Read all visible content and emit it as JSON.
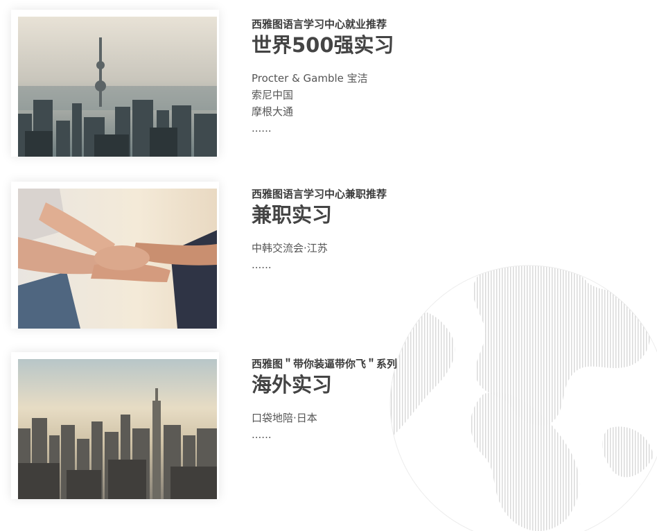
{
  "sections": [
    {
      "subtitle": "西雅图语言学习中心就业推荐",
      "title": "世界500强实习",
      "items": [
        "Procter & Gamble 宝洁",
        "索尼中国",
        "摩根大通",
        "......"
      ]
    },
    {
      "subtitle": "西雅图语言学习中心兼职推荐",
      "title": "兼职实习",
      "items": [
        "中韩交流会·江苏",
        "......"
      ]
    },
    {
      "subtitle": "西雅图＂带你装逼带你飞＂系列",
      "title": "海外实习",
      "items": [
        "口袋地陪·日本",
        "......"
      ]
    }
  ],
  "images": [
    "shanghai-skyline-photo",
    "stacked-hands-photo",
    "new-york-skyline-photo"
  ],
  "decoration": "globe-line-art",
  "colors": {
    "text_dark": "#444444",
    "text_body": "#555555",
    "globe_lines": "#e3e3e3"
  }
}
